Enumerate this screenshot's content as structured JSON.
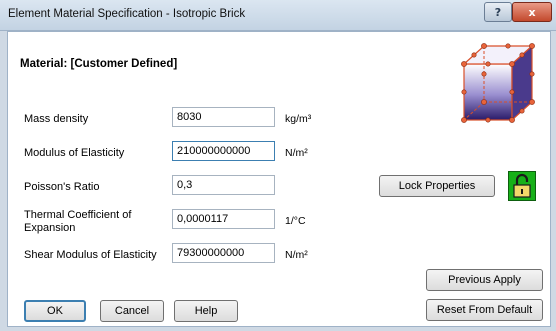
{
  "window": {
    "title": "Element Material Specification - Isotropic Brick",
    "help_glyph": "?",
    "close_glyph": "x"
  },
  "material": {
    "label": "Material: [Customer Defined]"
  },
  "fields": [
    {
      "label": "Mass density",
      "value": "8030",
      "unit": "kg/m³"
    },
    {
      "label": "Modulus of Elasticity",
      "value": "210000000000",
      "unit": "N/m²"
    },
    {
      "label": "Poisson's Ratio",
      "value": "0,3",
      "unit": ""
    },
    {
      "label": "Thermal Coefficient of Expansion",
      "value": "0,0000117",
      "unit": "1/°C"
    },
    {
      "label": "Shear Modulus of Elasticity",
      "value": "79300000000",
      "unit": "N/m²"
    }
  ],
  "buttons": {
    "lock_properties": "Lock Properties",
    "previous_apply": "Previous Apply",
    "reset_from_default": "Reset From Default",
    "ok": "OK",
    "cancel": "Cancel",
    "help": "Help"
  },
  "icons": {
    "cube": "brick-element-icon",
    "lock": "padlock-icon"
  },
  "colors": {
    "lock_green": "#17b018",
    "focus_blue": "#3c7fb1",
    "cube_purple": "#3a2a78",
    "node_orange": "#e8643a"
  }
}
